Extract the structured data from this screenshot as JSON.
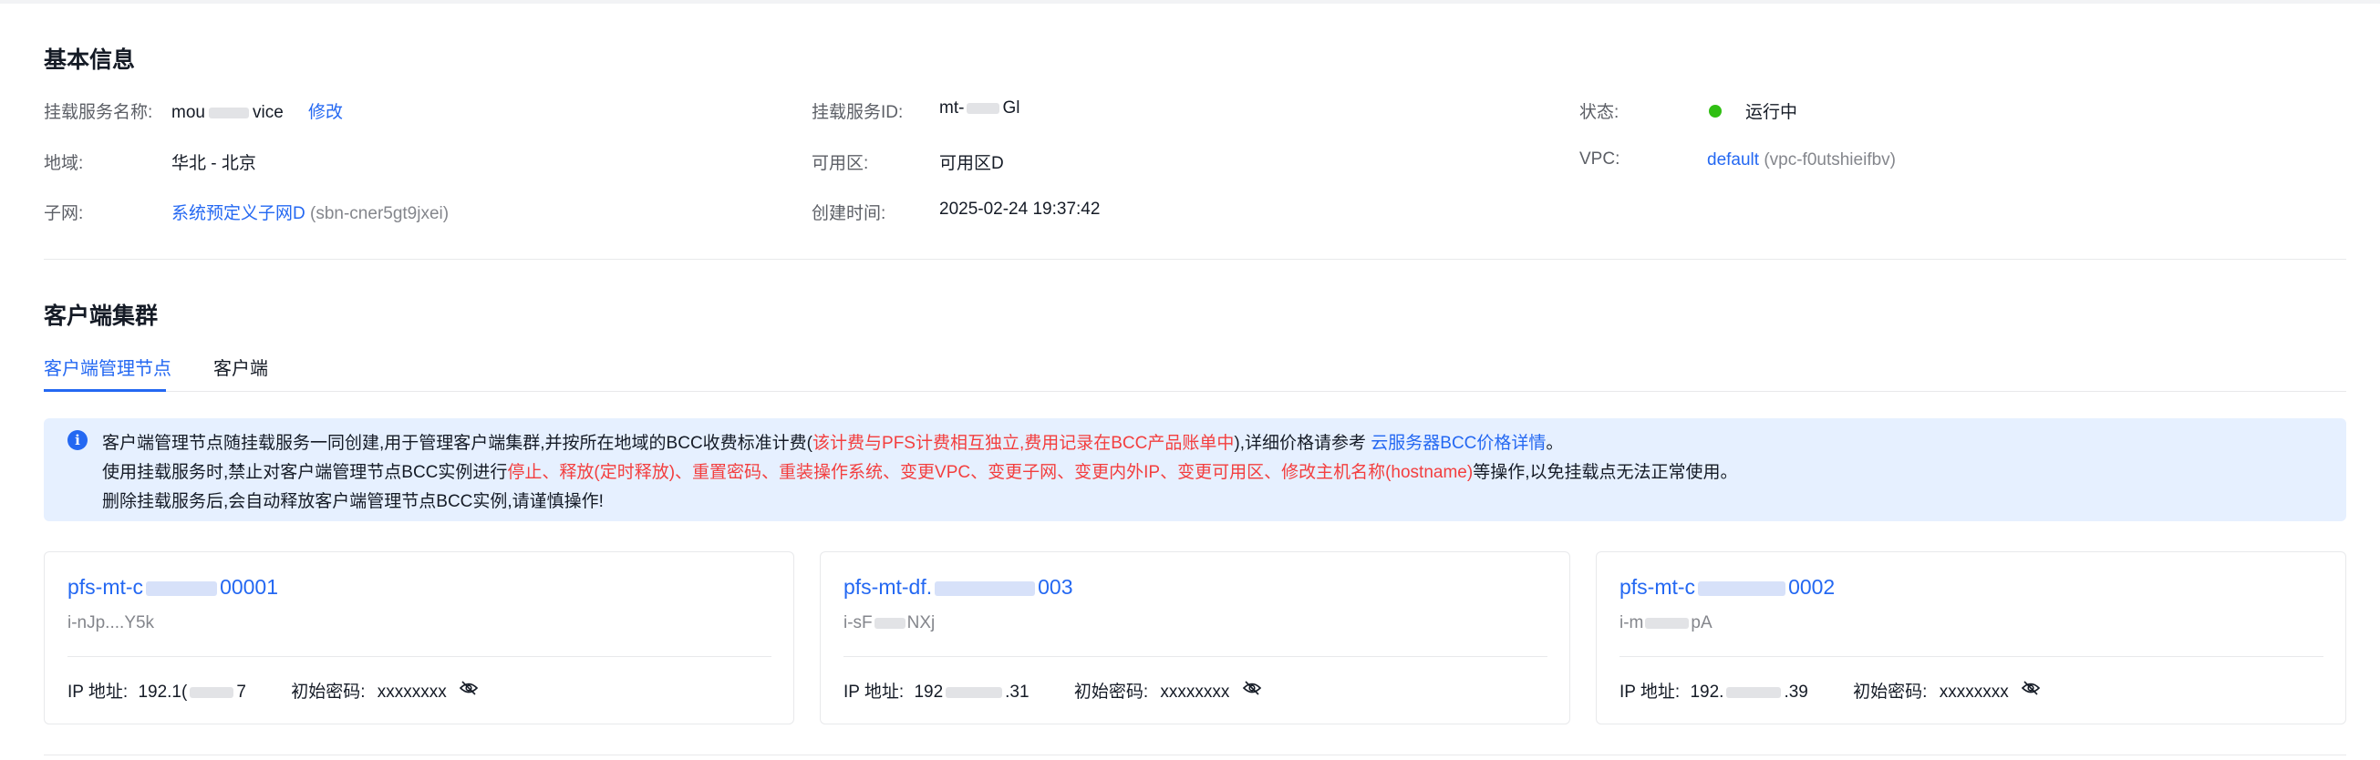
{
  "basic": {
    "title": "基本信息",
    "name_label": "挂载服务名称:",
    "name_value_a": "mou",
    "name_value_b": "vice",
    "edit_label": "修改",
    "id_label": "挂载服务ID:",
    "id_value_a": "mt-",
    "id_value_b": "Gl",
    "status_label": "状态:",
    "status_value": "运行中",
    "region_label": "地域:",
    "region_value": "华北 - 北京",
    "zone_label": "可用区:",
    "zone_value": "可用区D",
    "vpc_label": "VPC:",
    "vpc_link": "default",
    "vpc_id": "(vpc-f0utshieifbv)",
    "subnet_label": "子网:",
    "subnet_link": "系统预定义子网D",
    "subnet_id": "(sbn-cner5gt9jxei)",
    "created_label": "创建时间:",
    "created_value": "2025-02-24 19:37:42"
  },
  "colors": {
    "accent": "#2468f2",
    "status_running": "#30bf13",
    "warning_text": "#f33e3e",
    "alert_bg": "#e6f0ff"
  },
  "cluster": {
    "title": "客户端集群",
    "tabs": [
      {
        "label": "客户端管理节点"
      },
      {
        "label": "客户端"
      }
    ],
    "alert": {
      "line1_a": "客户端管理节点随挂载服务一同创建,用于管理客户端集群,并按所在地域的BCC收费标准计费(",
      "line1_red": "该计费与PFS计费相互独立,费用记录在BCC产品账单中",
      "line1_b": "),详细价格请参考 ",
      "line1_link": "云服务器BCC价格详情",
      "line1_c": "。",
      "line2_a": "使用挂载服务时,禁止对客户端管理节点BCC实例进行",
      "line2_red": "停止、释放(定时释放)、重置密码、重装操作系统、变更VPC、变更子网、变更内外IP、变更可用区、修改主机名称(hostname)",
      "line2_b": "等操作,以免挂载点无法正常使用。",
      "line3": "删除挂载服务后,会自动释放客户端管理节点BCC实例,请谨慎操作!"
    },
    "nodes": [
      {
        "name_a": "pfs-mt-c",
        "name_b": "00001",
        "instance_a": "i-nJp....",
        "instance_b": "Y5k",
        "ip_label": "IP 地址:",
        "ip_a": "192.1(",
        "ip_b": "7",
        "pwd_label": "初始密码:",
        "pwd_value": "xxxxxxxx"
      },
      {
        "name_a": "pfs-mt-df.",
        "name_b": "003",
        "instance_a": "i-sF",
        "instance_b": "NXj",
        "ip_label": "IP 地址:",
        "ip_a": "192",
        "ip_b": ".31",
        "pwd_label": "初始密码:",
        "pwd_value": "xxxxxxxx"
      },
      {
        "name_a": "pfs-mt-c",
        "name_b": "0002",
        "instance_a": "i-m",
        "instance_b": "pA",
        "ip_label": "IP 地址:",
        "ip_a": "192.",
        "ip_b": ".39",
        "pwd_label": "初始密码:",
        "pwd_value": "xxxxxxxx"
      }
    ]
  }
}
